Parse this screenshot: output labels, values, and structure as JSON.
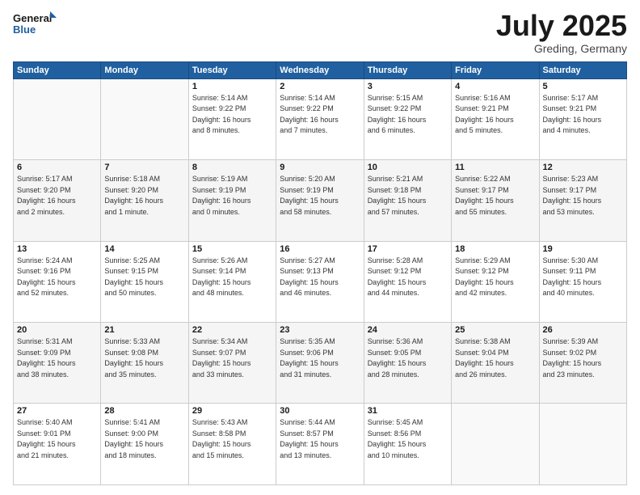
{
  "header": {
    "logo_line1": "General",
    "logo_line2": "Blue",
    "month": "July 2025",
    "location": "Greding, Germany"
  },
  "days_of_week": [
    "Sunday",
    "Monday",
    "Tuesday",
    "Wednesday",
    "Thursday",
    "Friday",
    "Saturday"
  ],
  "weeks": [
    [
      {
        "day": "",
        "info": ""
      },
      {
        "day": "",
        "info": ""
      },
      {
        "day": "1",
        "info": "Sunrise: 5:14 AM\nSunset: 9:22 PM\nDaylight: 16 hours\nand 8 minutes."
      },
      {
        "day": "2",
        "info": "Sunrise: 5:14 AM\nSunset: 9:22 PM\nDaylight: 16 hours\nand 7 minutes."
      },
      {
        "day": "3",
        "info": "Sunrise: 5:15 AM\nSunset: 9:22 PM\nDaylight: 16 hours\nand 6 minutes."
      },
      {
        "day": "4",
        "info": "Sunrise: 5:16 AM\nSunset: 9:21 PM\nDaylight: 16 hours\nand 5 minutes."
      },
      {
        "day": "5",
        "info": "Sunrise: 5:17 AM\nSunset: 9:21 PM\nDaylight: 16 hours\nand 4 minutes."
      }
    ],
    [
      {
        "day": "6",
        "info": "Sunrise: 5:17 AM\nSunset: 9:20 PM\nDaylight: 16 hours\nand 2 minutes."
      },
      {
        "day": "7",
        "info": "Sunrise: 5:18 AM\nSunset: 9:20 PM\nDaylight: 16 hours\nand 1 minute."
      },
      {
        "day": "8",
        "info": "Sunrise: 5:19 AM\nSunset: 9:19 PM\nDaylight: 16 hours\nand 0 minutes."
      },
      {
        "day": "9",
        "info": "Sunrise: 5:20 AM\nSunset: 9:19 PM\nDaylight: 15 hours\nand 58 minutes."
      },
      {
        "day": "10",
        "info": "Sunrise: 5:21 AM\nSunset: 9:18 PM\nDaylight: 15 hours\nand 57 minutes."
      },
      {
        "day": "11",
        "info": "Sunrise: 5:22 AM\nSunset: 9:17 PM\nDaylight: 15 hours\nand 55 minutes."
      },
      {
        "day": "12",
        "info": "Sunrise: 5:23 AM\nSunset: 9:17 PM\nDaylight: 15 hours\nand 53 minutes."
      }
    ],
    [
      {
        "day": "13",
        "info": "Sunrise: 5:24 AM\nSunset: 9:16 PM\nDaylight: 15 hours\nand 52 minutes."
      },
      {
        "day": "14",
        "info": "Sunrise: 5:25 AM\nSunset: 9:15 PM\nDaylight: 15 hours\nand 50 minutes."
      },
      {
        "day": "15",
        "info": "Sunrise: 5:26 AM\nSunset: 9:14 PM\nDaylight: 15 hours\nand 48 minutes."
      },
      {
        "day": "16",
        "info": "Sunrise: 5:27 AM\nSunset: 9:13 PM\nDaylight: 15 hours\nand 46 minutes."
      },
      {
        "day": "17",
        "info": "Sunrise: 5:28 AM\nSunset: 9:12 PM\nDaylight: 15 hours\nand 44 minutes."
      },
      {
        "day": "18",
        "info": "Sunrise: 5:29 AM\nSunset: 9:12 PM\nDaylight: 15 hours\nand 42 minutes."
      },
      {
        "day": "19",
        "info": "Sunrise: 5:30 AM\nSunset: 9:11 PM\nDaylight: 15 hours\nand 40 minutes."
      }
    ],
    [
      {
        "day": "20",
        "info": "Sunrise: 5:31 AM\nSunset: 9:09 PM\nDaylight: 15 hours\nand 38 minutes."
      },
      {
        "day": "21",
        "info": "Sunrise: 5:33 AM\nSunset: 9:08 PM\nDaylight: 15 hours\nand 35 minutes."
      },
      {
        "day": "22",
        "info": "Sunrise: 5:34 AM\nSunset: 9:07 PM\nDaylight: 15 hours\nand 33 minutes."
      },
      {
        "day": "23",
        "info": "Sunrise: 5:35 AM\nSunset: 9:06 PM\nDaylight: 15 hours\nand 31 minutes."
      },
      {
        "day": "24",
        "info": "Sunrise: 5:36 AM\nSunset: 9:05 PM\nDaylight: 15 hours\nand 28 minutes."
      },
      {
        "day": "25",
        "info": "Sunrise: 5:38 AM\nSunset: 9:04 PM\nDaylight: 15 hours\nand 26 minutes."
      },
      {
        "day": "26",
        "info": "Sunrise: 5:39 AM\nSunset: 9:02 PM\nDaylight: 15 hours\nand 23 minutes."
      }
    ],
    [
      {
        "day": "27",
        "info": "Sunrise: 5:40 AM\nSunset: 9:01 PM\nDaylight: 15 hours\nand 21 minutes."
      },
      {
        "day": "28",
        "info": "Sunrise: 5:41 AM\nSunset: 9:00 PM\nDaylight: 15 hours\nand 18 minutes."
      },
      {
        "day": "29",
        "info": "Sunrise: 5:43 AM\nSunset: 8:58 PM\nDaylight: 15 hours\nand 15 minutes."
      },
      {
        "day": "30",
        "info": "Sunrise: 5:44 AM\nSunset: 8:57 PM\nDaylight: 15 hours\nand 13 minutes."
      },
      {
        "day": "31",
        "info": "Sunrise: 5:45 AM\nSunset: 8:56 PM\nDaylight: 15 hours\nand 10 minutes."
      },
      {
        "day": "",
        "info": ""
      },
      {
        "day": "",
        "info": ""
      }
    ]
  ]
}
